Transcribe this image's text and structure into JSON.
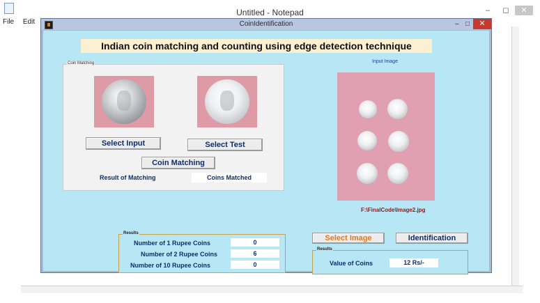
{
  "notepad": {
    "title": "Untitled - Notepad",
    "menu": [
      "File",
      "Edit"
    ],
    "controls": {
      "minimize": "–",
      "maximize": "◻",
      "close": "✕"
    }
  },
  "figure": {
    "title": "CoinIdentification",
    "controls": {
      "minimize": "–",
      "maximize": "□",
      "close": "✕"
    },
    "banner": "Indian coin matching and counting using edge detection technique",
    "matching_panel": {
      "legend": "Coin Matching",
      "select_input_label": "Select Input",
      "select_test_label": "Select Test",
      "coin_matching_label": "Coin Matching",
      "result_label": "Result of Matching",
      "result_value": "Coins Matched"
    },
    "input_image": {
      "label": "Input Image",
      "path": "F:\\FinalCode\\Image2.jpg"
    },
    "results_panel": {
      "legend": "Results",
      "rows": [
        {
          "label": "Number of 1 Rupee Coins",
          "value": "0"
        },
        {
          "label": "Number of 2 Rupee Coins",
          "value": "6"
        },
        {
          "label": "Number of 10 Rupee Coins",
          "value": "0"
        }
      ]
    },
    "select_image_label": "Select Image",
    "identification_label": "Identification",
    "value_panel": {
      "legend": "Results",
      "label": "Value of Coins",
      "value": "12 Rs/-"
    }
  },
  "colors": {
    "canvas": "#b7e6f5",
    "banner": "#fbf0d1",
    "button_text": "#0f2e6b",
    "select_image_text": "#e07a1e",
    "path_text": "#8b1a1a",
    "coin_tile": "#de9aa5"
  }
}
